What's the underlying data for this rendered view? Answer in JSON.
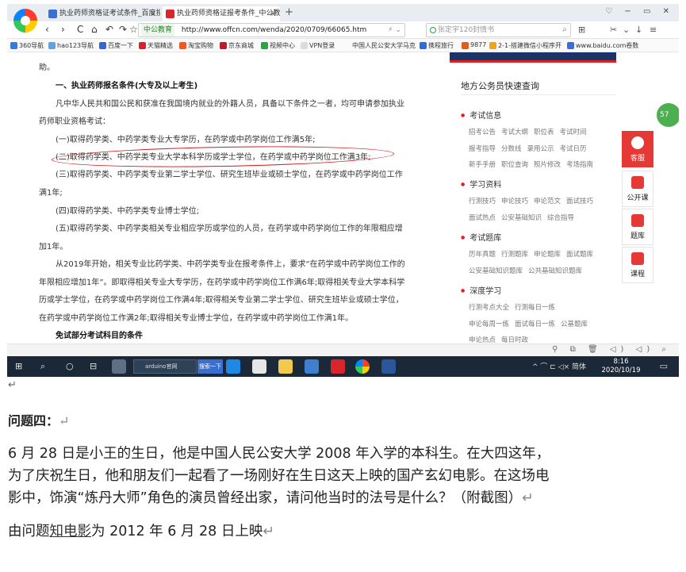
{
  "browser": {
    "tabs": [
      {
        "title": "执业药师资格证考试条件_百度搜",
        "close": "×"
      },
      {
        "title": "执业药师资格证报考条件_中公教",
        "close": "×"
      }
    ],
    "new_tab": "+",
    "window_controls": "♡ − ▭ ✕",
    "nav": {
      "back": "‹",
      "forward": "›",
      "refresh": "C",
      "home": "⌂",
      "undo": "↶",
      "forward2": "↷",
      "star": "☆"
    },
    "address": {
      "tag": "中公教育",
      "url": "http://www.offcn.com/wenda/2020/0709/66065.htm",
      "icons": "⚡ ⌄"
    },
    "search": {
      "placeholder": "张定宇120封情书",
      "icon": "⌕"
    },
    "right_tools": [
      "⊞",
      "✂",
      "⌄",
      "↓",
      "≡"
    ],
    "bookmarks": [
      "360导航",
      "hao123导航",
      "百度一下",
      "天猫精选",
      "淘宝购物",
      "京东商城",
      "视频中心",
      "VPN登录",
      "中国人民公安大学马克",
      "携程旅行",
      "9877",
      "2-1-搭建微信小程序开",
      "www.baidu.com卷数"
    ]
  },
  "article": {
    "intro": "助。",
    "section1": "一、执业药师报名条件(大专及以上考生)",
    "p1a": "凡中华人民共和国公民和获准在我国境内就业的外籍人员，具备以下条件之一者，均可申请参加执业",
    "p1b": "药师职业资格考试：",
    "c1": "(一)取得药学类、中药学类专业大专学历，在药学或中药学岗位工作满5年;",
    "c2": "(二)取得药学类、中药学类专业大学本科学历或学士学位，在药学或中药学岗位工作满3年;",
    "c3a": "(三)取得药学类、中药学类专业第二学士学位、研究生班毕业或硕士学位，在药学或中药学岗位工作",
    "c3b": "满1年;",
    "c4": "(四)取得药学类、中药学类专业博士学位;",
    "c5a": "(五)取得药学类、中药学类相关专业相应学历或学位的人员，在药学或中药学岗位工作的年限相应增",
    "c5b": "加1年。",
    "p2a": "从2019年开始，相关专业比药学类、中药学类专业在报考条件上，要求“在药学或中药学岗位工作的",
    "p2b": "年限相应增加1年”。即取得相关专业大专学历，在药学或中药学岗位工作满6年;取得相关专业大学本科学",
    "p2c": "历或学士学位，在药学或中药学岗位工作满4年;取得相关专业第二学士学位、研究生班毕业或硕士学位，",
    "p2d": "在药学或中药学岗位工作满2年;取得相关专业博士学位，在药学或中药学岗位工作满1年。",
    "section2": "免试部分考试科目的条件"
  },
  "sidebar": {
    "title": "地方公务员快速查询",
    "groups": [
      {
        "head": "考试信息",
        "rows": [
          [
            "招考公告",
            "考试大纲",
            "职位表",
            "考试时间"
          ],
          [
            "报考指导",
            "分数线",
            "录用公示",
            "考试日历"
          ],
          [
            "新手手册",
            "职位查询",
            "照片修改",
            "考场指南"
          ]
        ]
      },
      {
        "head": "学习资料",
        "rows": [
          [
            "行测技巧",
            "申论技巧",
            "申论范文",
            "面试技巧"
          ],
          [
            "面试热点",
            "公安基础知识",
            "综合指导"
          ]
        ]
      },
      {
        "head": "考试题库",
        "rows": [
          [
            "历年真题",
            "行测题库",
            "申论题库",
            "面试题库"
          ],
          [
            "公安基础知识题库",
            "公共基础知识题库"
          ]
        ]
      },
      {
        "head": "深度学习",
        "rows": [
          [
            "行测考点大全",
            "行测每日一练"
          ],
          [
            "申论每周一练",
            "面试每日一练",
            "公基题库"
          ],
          [
            "申论热点",
            "每日时政"
          ]
        ]
      }
    ]
  },
  "float_tools": [
    {
      "label": "客服",
      "icon": "headset-icon"
    },
    {
      "label": "公开课",
      "icon": "video-icon"
    },
    {
      "label": "题库",
      "icon": "list-icon"
    },
    {
      "label": "课程",
      "icon": "book-icon"
    }
  ],
  "green_badge": "57",
  "statusbar": {
    "icons": "⚲ ⧉ 🗑 ◁) ◁) ⌕"
  },
  "taskbar": {
    "start": "⊞",
    "search_glyph": "⌕",
    "cortana": "○",
    "taskview": "⊟",
    "arduino_box": "arduino官网",
    "search_button": "搜索一下",
    "system": "^ ⌒ ⊏ ◁× 简体",
    "time": "8:16",
    "date": "2020/10/19",
    "notify": "▭"
  },
  "document": {
    "return_mark": "↵",
    "q4_title": "问题四：",
    "body1": "6 月 28 日是小王的生日，他是中国人民公安大学 2008 年入学的本科生。在大四这年，",
    "body2": "为了庆祝生日，他和朋友们一起看了一场刚好在生日这天上映的国产玄幻电影。在这场电",
    "body3": "影中，饰演“炼丹大师”角色的演员曾经出家，请问他当时的法号是什么？（附截图）",
    "body4_prefix": "由问题",
    "body4_link": "知电影",
    "body4_suffix": "为 2012 年 6 月 28 日上映"
  }
}
